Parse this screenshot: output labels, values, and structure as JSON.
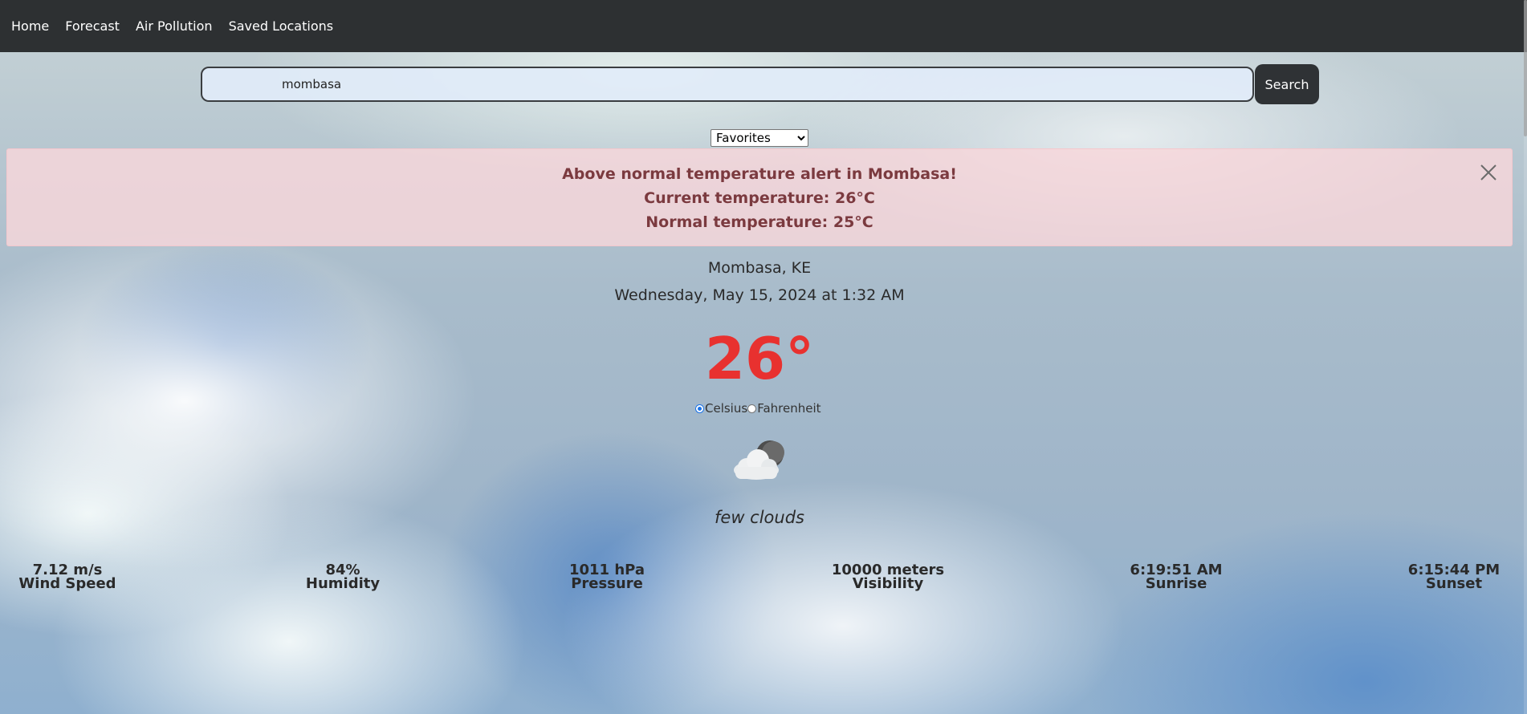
{
  "nav": {
    "items": [
      {
        "label": "Home"
      },
      {
        "label": "Forecast"
      },
      {
        "label": "Air Pollution"
      },
      {
        "label": "Saved Locations"
      }
    ]
  },
  "search": {
    "value": "mombasa",
    "button_label": "Search"
  },
  "favorites": {
    "selected": "Favorites"
  },
  "alert": {
    "headline": "Above normal temperature alert in Mombasa!",
    "current": "Current temperature: 26°C",
    "normal": "Normal temperature: 25°C",
    "close_icon": "close-icon"
  },
  "weather": {
    "location": "Mombasa, KE",
    "datetime": "Wednesday, May 15, 2024 at 1:32 AM",
    "temperature": "26°",
    "units": {
      "celsius": "Celsius",
      "fahrenheit": "Fahrenheit",
      "selected": "celsius"
    },
    "icon": "few-clouds-night-icon",
    "description": "few clouds"
  },
  "stats": [
    {
      "value": "7.12 m/s",
      "label": "Wind Speed"
    },
    {
      "value": "84%",
      "label": "Humidity"
    },
    {
      "value": "1011 hPa",
      "label": "Pressure"
    },
    {
      "value": "10000 meters",
      "label": "Visibility"
    },
    {
      "value": "6:19:51 AM",
      "label": "Sunrise"
    },
    {
      "value": "6:15:44 PM",
      "label": "Sunset"
    }
  ],
  "colors": {
    "temperature": "#e8312f",
    "alert_bg": "#f8d7da",
    "alert_text": "#7b3a3f",
    "navbar": "#2d3032"
  }
}
